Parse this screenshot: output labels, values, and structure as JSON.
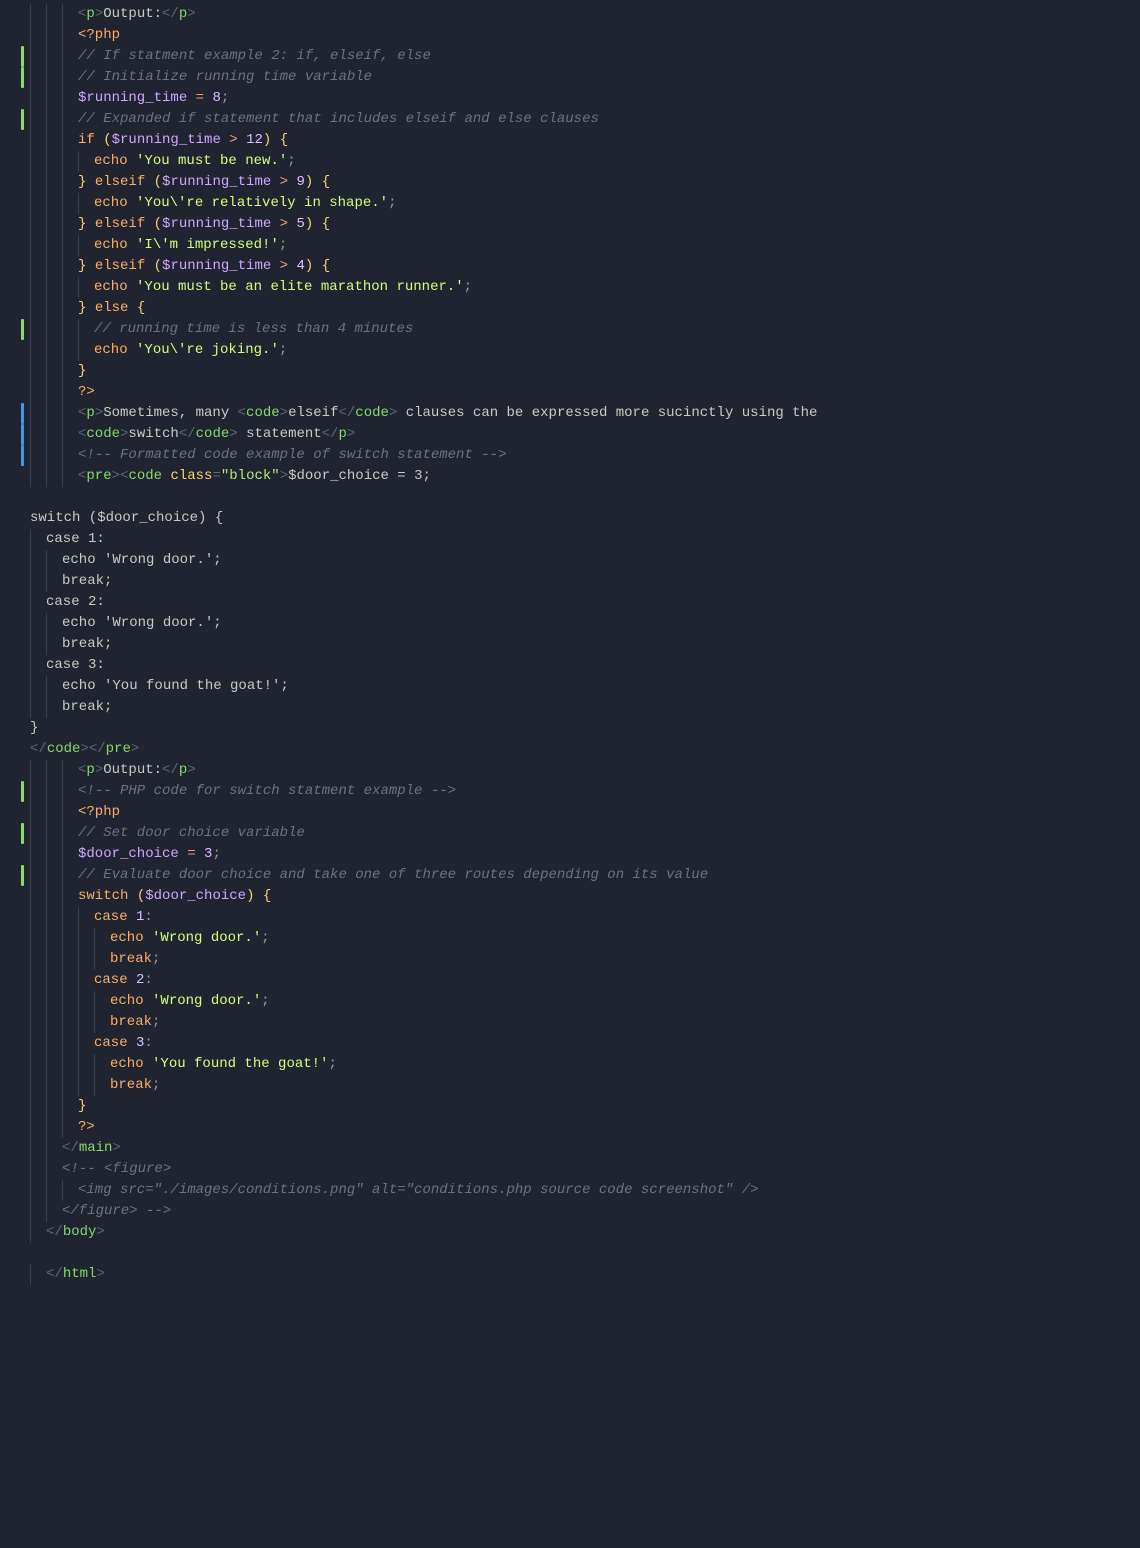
{
  "code_lines": [
    {
      "indent": 3,
      "mark": null,
      "tokens": [
        {
          "c": "punct",
          "t": "<"
        },
        {
          "c": "tag",
          "t": "p"
        },
        {
          "c": "punct",
          "t": ">"
        },
        {
          "c": "txt",
          "t": "Output:"
        },
        {
          "c": "punct",
          "t": "</"
        },
        {
          "c": "tag",
          "t": "p"
        },
        {
          "c": "punct",
          "t": ">"
        }
      ]
    },
    {
      "indent": 3,
      "mark": null,
      "tokens": [
        {
          "c": "php",
          "t": "<?php"
        }
      ]
    },
    {
      "indent": 3,
      "mark": "green",
      "tokens": [
        {
          "c": "comment",
          "t": "// If statment example 2: if, elseif, else"
        }
      ]
    },
    {
      "indent": 3,
      "mark": "green",
      "tokens": [
        {
          "c": "comment",
          "t": "// Initialize running time variable"
        }
      ]
    },
    {
      "indent": 3,
      "mark": null,
      "tokens": [
        {
          "c": "var",
          "t": "$running_time"
        },
        {
          "c": "txt",
          "t": " "
        },
        {
          "c": "op",
          "t": "="
        },
        {
          "c": "txt",
          "t": " "
        },
        {
          "c": "num",
          "t": "8"
        },
        {
          "c": "semi",
          "t": ";"
        }
      ]
    },
    {
      "indent": 3,
      "mark": "green",
      "tokens": [
        {
          "c": "comment",
          "t": "// Expanded if statement that includes elseif and else clauses"
        }
      ]
    },
    {
      "indent": 3,
      "mark": null,
      "tokens": [
        {
          "c": "kw",
          "t": "if"
        },
        {
          "c": "txt",
          "t": " "
        },
        {
          "c": "bracket1",
          "t": "("
        },
        {
          "c": "var",
          "t": "$running_time"
        },
        {
          "c": "txt",
          "t": " "
        },
        {
          "c": "op",
          "t": ">"
        },
        {
          "c": "txt",
          "t": " "
        },
        {
          "c": "num",
          "t": "12"
        },
        {
          "c": "bracket1",
          "t": ")"
        },
        {
          "c": "txt",
          "t": " "
        },
        {
          "c": "bracket1",
          "t": "{"
        }
      ]
    },
    {
      "indent": 4,
      "mark": null,
      "tokens": [
        {
          "c": "kw",
          "t": "echo"
        },
        {
          "c": "txt",
          "t": " "
        },
        {
          "c": "str",
          "t": "'You must be new.'"
        },
        {
          "c": "semi",
          "t": ";"
        }
      ]
    },
    {
      "indent": 3,
      "mark": null,
      "tokens": [
        {
          "c": "bracket1",
          "t": "}"
        },
        {
          "c": "txt",
          "t": " "
        },
        {
          "c": "kw",
          "t": "elseif"
        },
        {
          "c": "txt",
          "t": " "
        },
        {
          "c": "bracket1",
          "t": "("
        },
        {
          "c": "var",
          "t": "$running_time"
        },
        {
          "c": "txt",
          "t": " "
        },
        {
          "c": "op",
          "t": ">"
        },
        {
          "c": "txt",
          "t": " "
        },
        {
          "c": "num",
          "t": "9"
        },
        {
          "c": "bracket1",
          "t": ")"
        },
        {
          "c": "txt",
          "t": " "
        },
        {
          "c": "bracket1",
          "t": "{"
        }
      ]
    },
    {
      "indent": 4,
      "mark": null,
      "tokens": [
        {
          "c": "kw",
          "t": "echo"
        },
        {
          "c": "txt",
          "t": " "
        },
        {
          "c": "str",
          "t": "'You\\'re relatively in shape.'"
        },
        {
          "c": "semi",
          "t": ";"
        }
      ]
    },
    {
      "indent": 3,
      "mark": null,
      "tokens": [
        {
          "c": "bracket1",
          "t": "}"
        },
        {
          "c": "txt",
          "t": " "
        },
        {
          "c": "kw",
          "t": "elseif"
        },
        {
          "c": "txt",
          "t": " "
        },
        {
          "c": "bracket1",
          "t": "("
        },
        {
          "c": "var",
          "t": "$running_time"
        },
        {
          "c": "txt",
          "t": " "
        },
        {
          "c": "op",
          "t": ">"
        },
        {
          "c": "txt",
          "t": " "
        },
        {
          "c": "num",
          "t": "5"
        },
        {
          "c": "bracket1",
          "t": ")"
        },
        {
          "c": "txt",
          "t": " "
        },
        {
          "c": "bracket1",
          "t": "{"
        }
      ]
    },
    {
      "indent": 4,
      "mark": null,
      "tokens": [
        {
          "c": "kw",
          "t": "echo"
        },
        {
          "c": "txt",
          "t": " "
        },
        {
          "c": "str",
          "t": "'I\\'m impressed!'"
        },
        {
          "c": "semi",
          "t": ";"
        }
      ]
    },
    {
      "indent": 3,
      "mark": null,
      "tokens": [
        {
          "c": "bracket1",
          "t": "}"
        },
        {
          "c": "txt",
          "t": " "
        },
        {
          "c": "kw",
          "t": "elseif"
        },
        {
          "c": "txt",
          "t": " "
        },
        {
          "c": "bracket1",
          "t": "("
        },
        {
          "c": "var",
          "t": "$running_time"
        },
        {
          "c": "txt",
          "t": " "
        },
        {
          "c": "op",
          "t": ">"
        },
        {
          "c": "txt",
          "t": " "
        },
        {
          "c": "num",
          "t": "4"
        },
        {
          "c": "bracket1",
          "t": ")"
        },
        {
          "c": "txt",
          "t": " "
        },
        {
          "c": "bracket1",
          "t": "{"
        }
      ]
    },
    {
      "indent": 4,
      "mark": null,
      "tokens": [
        {
          "c": "kw",
          "t": "echo"
        },
        {
          "c": "txt",
          "t": " "
        },
        {
          "c": "str",
          "t": "'You must be an elite marathon runner.'"
        },
        {
          "c": "semi",
          "t": ";"
        }
      ]
    },
    {
      "indent": 3,
      "mark": null,
      "tokens": [
        {
          "c": "bracket1",
          "t": "}"
        },
        {
          "c": "txt",
          "t": " "
        },
        {
          "c": "kw",
          "t": "else"
        },
        {
          "c": "txt",
          "t": " "
        },
        {
          "c": "bracket1",
          "t": "{"
        }
      ]
    },
    {
      "indent": 4,
      "mark": "green",
      "tokens": [
        {
          "c": "comment",
          "t": "// running time is less than 4 minutes"
        }
      ]
    },
    {
      "indent": 4,
      "mark": null,
      "tokens": [
        {
          "c": "kw",
          "t": "echo"
        },
        {
          "c": "txt",
          "t": " "
        },
        {
          "c": "str",
          "t": "'You\\'re joking.'"
        },
        {
          "c": "semi",
          "t": ";"
        }
      ]
    },
    {
      "indent": 3,
      "mark": null,
      "tokens": [
        {
          "c": "bracket1",
          "t": "}"
        }
      ]
    },
    {
      "indent": 3,
      "mark": null,
      "tokens": [
        {
          "c": "php",
          "t": "?>"
        }
      ]
    },
    {
      "indent": 3,
      "mark": "blue",
      "tokens": [
        {
          "c": "punct",
          "t": "<"
        },
        {
          "c": "tag",
          "t": "p"
        },
        {
          "c": "punct",
          "t": ">"
        },
        {
          "c": "txt",
          "t": "Sometimes, many "
        },
        {
          "c": "punct",
          "t": "<"
        },
        {
          "c": "tag",
          "t": "code"
        },
        {
          "c": "punct",
          "t": ">"
        },
        {
          "c": "txt",
          "t": "elseif"
        },
        {
          "c": "punct",
          "t": "</"
        },
        {
          "c": "tag",
          "t": "code"
        },
        {
          "c": "punct",
          "t": ">"
        },
        {
          "c": "txt",
          "t": " clauses can be expressed more sucinctly using the"
        }
      ]
    },
    {
      "indent": 3,
      "mark": "blue",
      "tokens": [
        {
          "c": "punct",
          "t": "<"
        },
        {
          "c": "tag",
          "t": "code"
        },
        {
          "c": "punct",
          "t": ">"
        },
        {
          "c": "txt",
          "t": "switch"
        },
        {
          "c": "punct",
          "t": "</"
        },
        {
          "c": "tag",
          "t": "code"
        },
        {
          "c": "punct",
          "t": ">"
        },
        {
          "c": "txt",
          "t": " statement"
        },
        {
          "c": "punct",
          "t": "</"
        },
        {
          "c": "tag",
          "t": "p"
        },
        {
          "c": "punct",
          "t": ">"
        }
      ]
    },
    {
      "indent": 3,
      "mark": "blue",
      "tokens": [
        {
          "c": "htmlcomment",
          "t": "<!-- Formatted code example of switch statement -->"
        }
      ]
    },
    {
      "indent": 3,
      "mark": null,
      "tokens": [
        {
          "c": "punct",
          "t": "<"
        },
        {
          "c": "tag",
          "t": "pre"
        },
        {
          "c": "punct",
          "t": ">"
        },
        {
          "c": "punct",
          "t": "<"
        },
        {
          "c": "tag",
          "t": "code"
        },
        {
          "c": "txt",
          "t": " "
        },
        {
          "c": "attr",
          "t": "class"
        },
        {
          "c": "punct",
          "t": "="
        },
        {
          "c": "attrval",
          "t": "\"block\""
        },
        {
          "c": "punct",
          "t": ">"
        },
        {
          "c": "txt",
          "t": "$door_choice = 3;"
        }
      ]
    },
    {
      "indent": 0,
      "mark": null,
      "tokens": [
        {
          "c": "txt",
          "t": ""
        }
      ]
    },
    {
      "indent": 0,
      "mark": null,
      "tokens": [
        {
          "c": "txt",
          "t": "switch ($door_choice) {"
        }
      ]
    },
    {
      "indent": 1,
      "mark": null,
      "tokens": [
        {
          "c": "txt",
          "t": "case 1:"
        }
      ]
    },
    {
      "indent": 2,
      "mark": null,
      "tokens": [
        {
          "c": "txt",
          "t": "echo 'Wrong door.';"
        }
      ]
    },
    {
      "indent": 2,
      "mark": null,
      "tokens": [
        {
          "c": "txt",
          "t": "break;"
        }
      ]
    },
    {
      "indent": 1,
      "mark": null,
      "tokens": [
        {
          "c": "txt",
          "t": "case 2:"
        }
      ]
    },
    {
      "indent": 2,
      "mark": null,
      "tokens": [
        {
          "c": "txt",
          "t": "echo 'Wrong door.';"
        }
      ]
    },
    {
      "indent": 2,
      "mark": null,
      "tokens": [
        {
          "c": "txt",
          "t": "break;"
        }
      ]
    },
    {
      "indent": 1,
      "mark": null,
      "tokens": [
        {
          "c": "txt",
          "t": "case 3:"
        }
      ]
    },
    {
      "indent": 2,
      "mark": null,
      "tokens": [
        {
          "c": "txt",
          "t": "echo 'You found the goat!';"
        }
      ]
    },
    {
      "indent": 2,
      "mark": null,
      "tokens": [
        {
          "c": "txt",
          "t": "break;"
        }
      ]
    },
    {
      "indent": 0,
      "mark": null,
      "tokens": [
        {
          "c": "txt",
          "t": "}"
        }
      ]
    },
    {
      "indent": 0,
      "mark": null,
      "tokens": [
        {
          "c": "punct",
          "t": "</"
        },
        {
          "c": "tag",
          "t": "code"
        },
        {
          "c": "punct",
          "t": ">"
        },
        {
          "c": "punct",
          "t": "</"
        },
        {
          "c": "tag",
          "t": "pre"
        },
        {
          "c": "punct",
          "t": ">"
        }
      ]
    },
    {
      "indent": 3,
      "mark": null,
      "tokens": [
        {
          "c": "punct",
          "t": "<"
        },
        {
          "c": "tag",
          "t": "p"
        },
        {
          "c": "punct",
          "t": ">"
        },
        {
          "c": "txt",
          "t": "Output:"
        },
        {
          "c": "punct",
          "t": "</"
        },
        {
          "c": "tag",
          "t": "p"
        },
        {
          "c": "punct",
          "t": ">"
        }
      ]
    },
    {
      "indent": 3,
      "mark": "green",
      "tokens": [
        {
          "c": "htmlcomment",
          "t": "<!-- PHP code for switch statment example -->"
        }
      ]
    },
    {
      "indent": 3,
      "mark": null,
      "tokens": [
        {
          "c": "php",
          "t": "<?php"
        }
      ]
    },
    {
      "indent": 3,
      "mark": "green",
      "tokens": [
        {
          "c": "comment",
          "t": "// Set door choice variable"
        }
      ]
    },
    {
      "indent": 3,
      "mark": null,
      "tokens": [
        {
          "c": "var",
          "t": "$door_choice"
        },
        {
          "c": "txt",
          "t": " "
        },
        {
          "c": "op",
          "t": "="
        },
        {
          "c": "txt",
          "t": " "
        },
        {
          "c": "num",
          "t": "3"
        },
        {
          "c": "semi",
          "t": ";"
        }
      ]
    },
    {
      "indent": 3,
      "mark": "green",
      "tokens": [
        {
          "c": "comment",
          "t": "// Evaluate door choice and take one of three routes depending on its value"
        }
      ]
    },
    {
      "indent": 3,
      "mark": null,
      "tokens": [
        {
          "c": "kw",
          "t": "switch"
        },
        {
          "c": "txt",
          "t": " "
        },
        {
          "c": "bracket1",
          "t": "("
        },
        {
          "c": "var",
          "t": "$door_choice"
        },
        {
          "c": "bracket1",
          "t": ")"
        },
        {
          "c": "txt",
          "t": " "
        },
        {
          "c": "bracket1",
          "t": "{"
        }
      ]
    },
    {
      "indent": 4,
      "mark": null,
      "tokens": [
        {
          "c": "kw",
          "t": "case"
        },
        {
          "c": "txt",
          "t": " "
        },
        {
          "c": "num",
          "t": "1"
        },
        {
          "c": "semi",
          "t": ":"
        }
      ]
    },
    {
      "indent": 5,
      "mark": null,
      "tokens": [
        {
          "c": "kw",
          "t": "echo"
        },
        {
          "c": "txt",
          "t": " "
        },
        {
          "c": "str",
          "t": "'Wrong door.'"
        },
        {
          "c": "semi",
          "t": ";"
        }
      ]
    },
    {
      "indent": 5,
      "mark": null,
      "tokens": [
        {
          "c": "kw",
          "t": "break"
        },
        {
          "c": "semi",
          "t": ";"
        }
      ]
    },
    {
      "indent": 4,
      "mark": null,
      "tokens": [
        {
          "c": "kw",
          "t": "case"
        },
        {
          "c": "txt",
          "t": " "
        },
        {
          "c": "num",
          "t": "2"
        },
        {
          "c": "semi",
          "t": ":"
        }
      ]
    },
    {
      "indent": 5,
      "mark": null,
      "tokens": [
        {
          "c": "kw",
          "t": "echo"
        },
        {
          "c": "txt",
          "t": " "
        },
        {
          "c": "str",
          "t": "'Wrong door.'"
        },
        {
          "c": "semi",
          "t": ";"
        }
      ]
    },
    {
      "indent": 5,
      "mark": null,
      "tokens": [
        {
          "c": "kw",
          "t": "break"
        },
        {
          "c": "semi",
          "t": ";"
        }
      ]
    },
    {
      "indent": 4,
      "mark": null,
      "tokens": [
        {
          "c": "kw",
          "t": "case"
        },
        {
          "c": "txt",
          "t": " "
        },
        {
          "c": "num",
          "t": "3"
        },
        {
          "c": "semi",
          "t": ":"
        }
      ]
    },
    {
      "indent": 5,
      "mark": null,
      "tokens": [
        {
          "c": "kw",
          "t": "echo"
        },
        {
          "c": "txt",
          "t": " "
        },
        {
          "c": "str",
          "t": "'You found the goat!'"
        },
        {
          "c": "semi",
          "t": ";"
        }
      ]
    },
    {
      "indent": 5,
      "mark": null,
      "tokens": [
        {
          "c": "kw",
          "t": "break"
        },
        {
          "c": "semi",
          "t": ";"
        }
      ]
    },
    {
      "indent": 3,
      "mark": null,
      "tokens": [
        {
          "c": "bracket1",
          "t": "}"
        }
      ]
    },
    {
      "indent": 3,
      "mark": null,
      "tokens": [
        {
          "c": "php",
          "t": "?>"
        }
      ]
    },
    {
      "indent": 2,
      "mark": null,
      "tokens": [
        {
          "c": "punct",
          "t": "</"
        },
        {
          "c": "tag",
          "t": "main"
        },
        {
          "c": "punct",
          "t": ">"
        }
      ]
    },
    {
      "indent": 2,
      "mark": null,
      "tokens": [
        {
          "c": "htmlcomment",
          "t": "<!-- <figure>"
        }
      ]
    },
    {
      "indent": 3,
      "mark": null,
      "tokens": [
        {
          "c": "htmlcomment",
          "t": "<img src=\"./images/conditions.png\" alt=\"conditions.php source code screenshot\" />"
        }
      ]
    },
    {
      "indent": 2,
      "mark": null,
      "tokens": [
        {
          "c": "htmlcomment",
          "t": "</figure> -->"
        }
      ]
    },
    {
      "indent": 1,
      "mark": null,
      "tokens": [
        {
          "c": "punct",
          "t": "</"
        },
        {
          "c": "tag",
          "t": "body"
        },
        {
          "c": "punct",
          "t": ">"
        }
      ]
    },
    {
      "indent": 0,
      "mark": null,
      "tokens": [
        {
          "c": "txt",
          "t": ""
        }
      ]
    },
    {
      "indent": 1,
      "mark": null,
      "tokens": [
        {
          "c": "punct",
          "t": "</"
        },
        {
          "c": "tag",
          "t": "html"
        },
        {
          "c": "punct",
          "t": ">"
        }
      ]
    }
  ]
}
